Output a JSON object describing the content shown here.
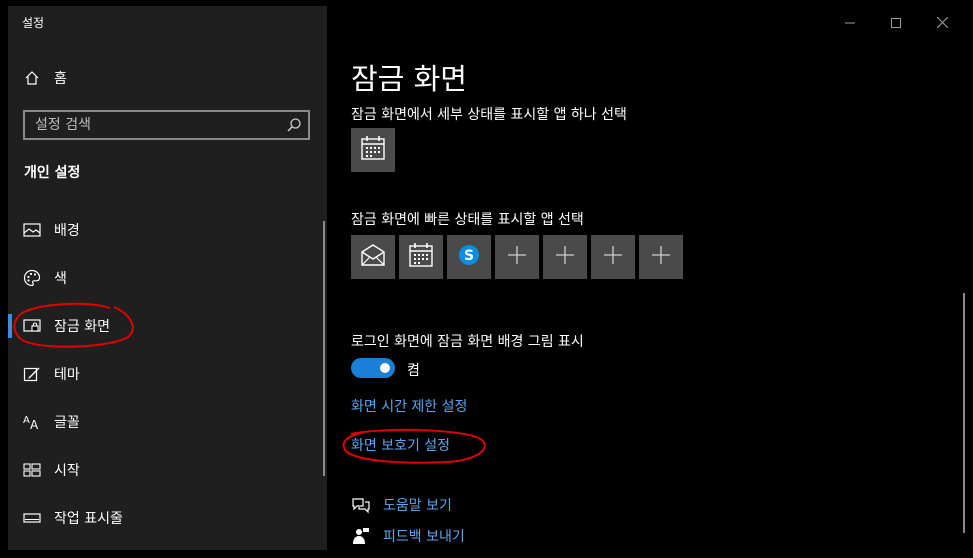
{
  "window": {
    "title": "설정"
  },
  "sidebar": {
    "home_label": "홈",
    "search_placeholder": "설정 검색",
    "section_title": "개인 설정",
    "items": [
      {
        "label": "배경",
        "icon": "picture-icon"
      },
      {
        "label": "색",
        "icon": "palette-icon"
      },
      {
        "label": "잠금 화면",
        "icon": "lock-screen-icon",
        "selected": true
      },
      {
        "label": "테마",
        "icon": "theme-brush-icon"
      },
      {
        "label": "글꼴",
        "icon": "font-icon"
      },
      {
        "label": "시작",
        "icon": "start-menu-icon"
      },
      {
        "label": "작업 표시줄",
        "icon": "taskbar-icon"
      }
    ]
  },
  "main": {
    "title": "잠금 화면",
    "detailed_status_label": "잠금 화면에서 세부 상태를 표시할 앱 하나 선택",
    "quick_status_label": "잠금 화면에 빠른 상태를 표시할 앱 선택",
    "signin_bg_label": "로그인 화면에 잠금 화면 배경 그림 표시",
    "toggle_state": "켬",
    "screen_timeout_link": "화면 시간 제한 설정",
    "screensaver_link": "화면 보호기 설정",
    "help_link": "도움말 보기",
    "feedback_link": "피드백 보내기"
  },
  "colors": {
    "accent": "#1a7fd6",
    "link": "#5aa7ef",
    "sidebar_bg": "#1f1f1f",
    "tile_bg": "#4a4a4a",
    "annotation": "#e00000"
  }
}
